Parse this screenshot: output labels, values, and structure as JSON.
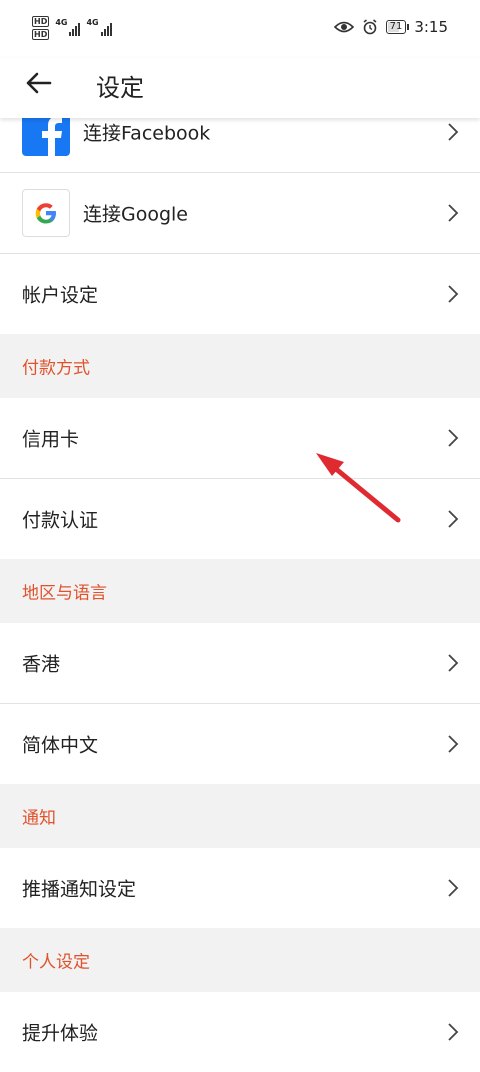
{
  "status_bar": {
    "sim1_label": "HD",
    "sim2_label": "HD",
    "net1": "4G",
    "net2": "4G",
    "battery": "71",
    "battery_level": 71,
    "time": "3:15"
  },
  "header": {
    "title": "设定"
  },
  "rows": {
    "facebook": "连接Facebook",
    "google": "连接Google",
    "account": "帐户设定",
    "payment_section": "付款方式",
    "credit_card": "信用卡",
    "payment_auth": "付款认证",
    "region_section": "地区与语言",
    "region": "香港",
    "language": "简体中文",
    "notify_section": "通知",
    "push": "推播通知设定",
    "personal_section": "个人设定",
    "experience": "提升体验"
  },
  "colors": {
    "section_text": "#e0522c",
    "section_bg": "#f2f2f2",
    "facebook_blue": "#1877f2",
    "annotation_arrow": "#e02a32"
  },
  "icons": {
    "back": "arrow-left-icon",
    "chevron": "chevron-right-icon",
    "facebook": "facebook-icon",
    "google": "google-icon"
  }
}
